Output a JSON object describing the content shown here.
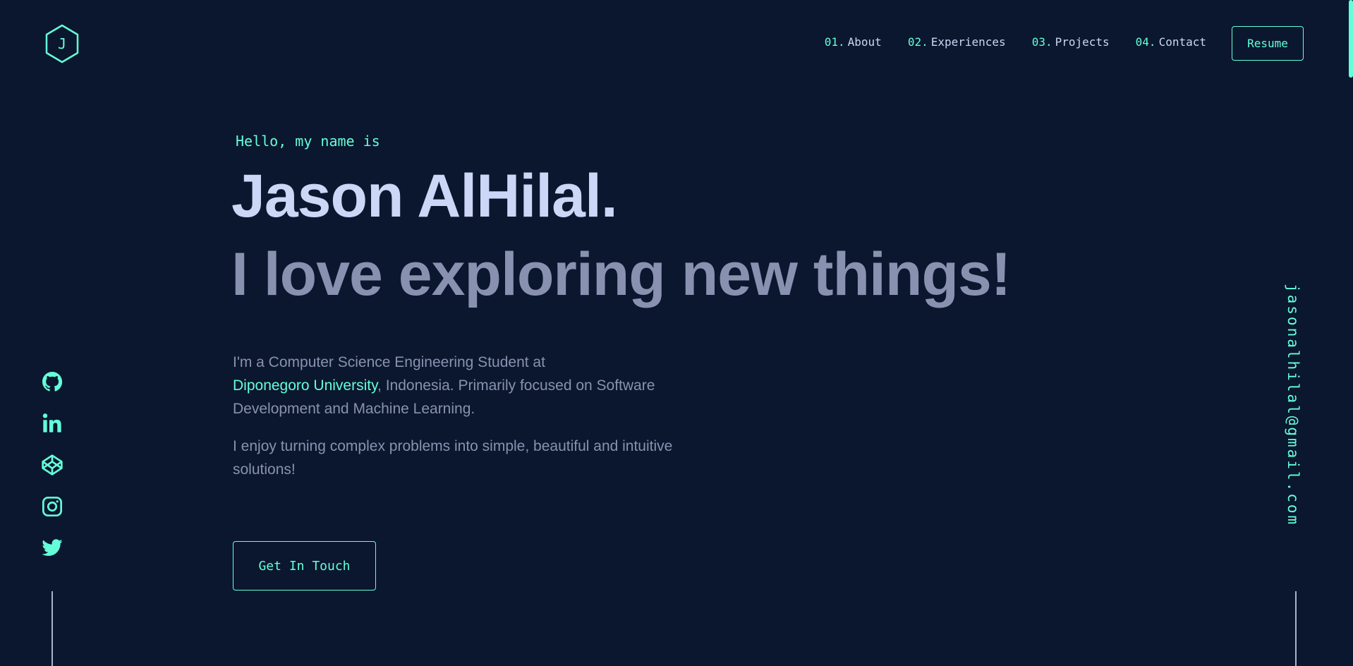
{
  "logo": {
    "letter": "J",
    "icon": "hexagon-logo-icon"
  },
  "nav": {
    "items": [
      {
        "num": "01.",
        "label": "About"
      },
      {
        "num": "02.",
        "label": "Experiences"
      },
      {
        "num": "03.",
        "label": "Projects"
      },
      {
        "num": "04.",
        "label": "Contact"
      }
    ],
    "resume_label": "Resume"
  },
  "hero": {
    "greeting": "Hello, my name is",
    "name": "Jason AlHilal.",
    "tagline": "I love exploring new things!",
    "bio_part1": "I'm a Computer Science Engineering Student at",
    "bio_link": "Diponegoro University",
    "bio_part2": ", Indonesia. Primarily focused on Software Development and Machine Learning.",
    "bio_second": "I enjoy turning complex problems into simple, beautiful and intuitive solutions!",
    "cta_label": "Get In Touch"
  },
  "social": {
    "icons": [
      "github-icon",
      "linkedin-icon",
      "codepen-icon",
      "instagram-icon",
      "twitter-icon"
    ]
  },
  "email": "jasonalhilal@gmail.com",
  "colors": {
    "background": "#0b172e",
    "accent": "#64ffda",
    "heading": "#ccd6f6",
    "text": "#8892b0"
  }
}
